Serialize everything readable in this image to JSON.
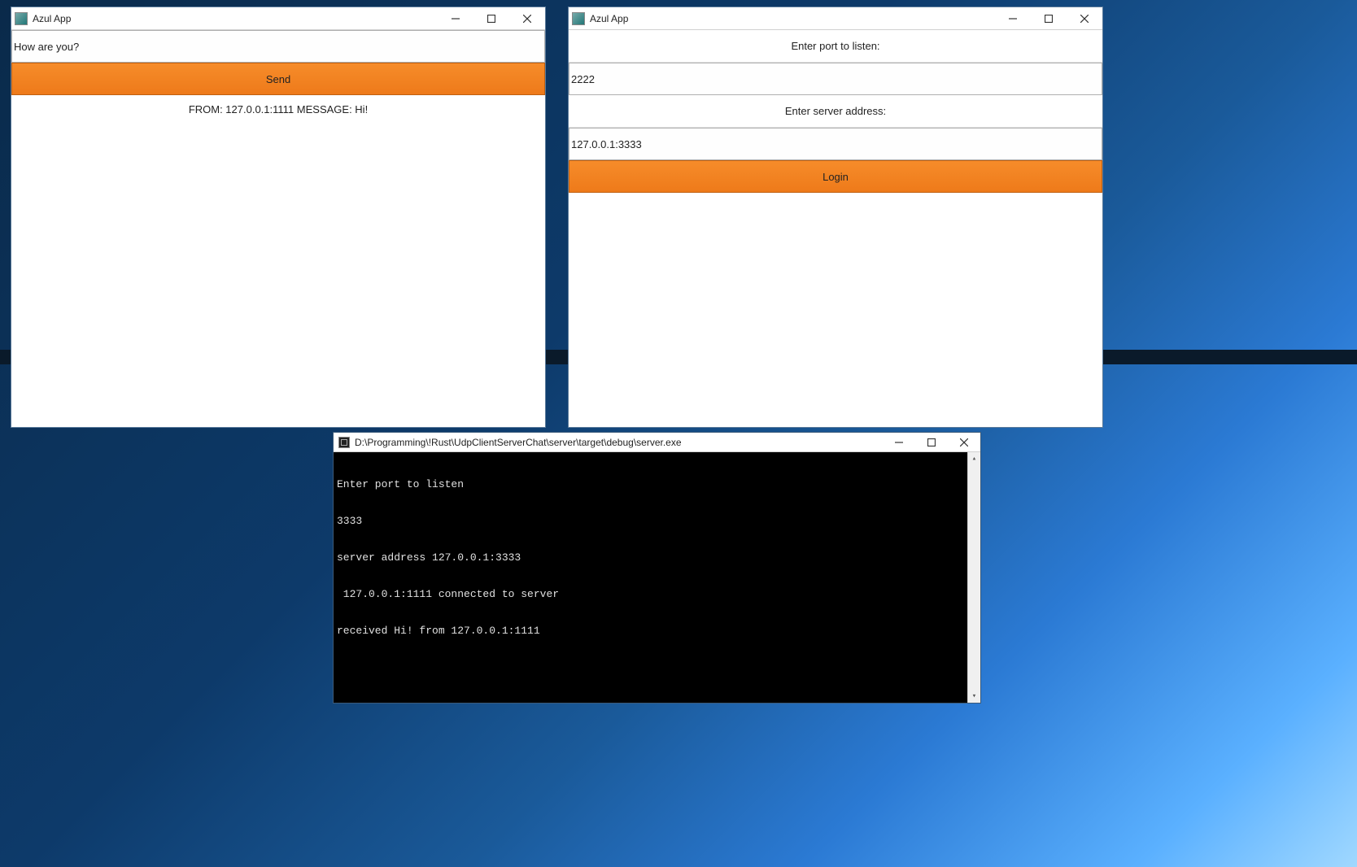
{
  "left_window": {
    "title": "Azul App",
    "message_input": "How are you?",
    "send_label": "Send",
    "received": "FROM: 127.0.0.1:1111 MESSAGE: Hi!"
  },
  "right_window": {
    "title": "Azul App",
    "port_label": "Enter port to listen:",
    "port_value": "2222",
    "server_label": "Enter server address:",
    "server_value": "127.0.0.1:3333",
    "login_label": "Login"
  },
  "console_window": {
    "title": "D:\\Programming\\!Rust\\UdpClientServerChat\\server\\target\\debug\\server.exe",
    "lines": [
      "Enter port to listen",
      "3333",
      "server address 127.0.0.1:3333",
      " 127.0.0.1:1111 connected to server",
      "received Hi! from 127.0.0.1:1111"
    ]
  }
}
